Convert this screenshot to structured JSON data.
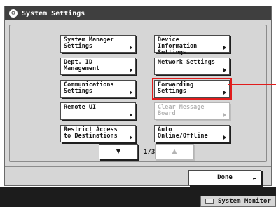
{
  "window": {
    "title": "System Settings",
    "title_icon": "settings-gear-icon"
  },
  "settings_buttons": [
    {
      "label": "System Manager Settings",
      "enabled": true
    },
    {
      "label": "Device Information Settings",
      "enabled": true
    },
    {
      "label": "Dept. ID Management",
      "enabled": true
    },
    {
      "label": "Network Settings",
      "enabled": true
    },
    {
      "label": "Communications Settings",
      "enabled": true
    },
    {
      "label": "Forwarding Settings",
      "enabled": true,
      "highlighted": true
    },
    {
      "label": "Remote UI",
      "enabled": true
    },
    {
      "label": "Clear Message Board",
      "enabled": false
    },
    {
      "label": "Restrict Access to Destinations",
      "enabled": true
    },
    {
      "label": "Auto Online/Offline",
      "enabled": true
    }
  ],
  "pager": {
    "down_glyph": "▼",
    "up_glyph": "▲",
    "page_indicator": "1/3",
    "up_enabled": false
  },
  "done_button": {
    "label": "Done",
    "enter_glyph": "↵"
  },
  "status_bar": {
    "system_monitor_label": "System Monitor"
  },
  "colors": {
    "highlight": "#e11c1c",
    "title_bar": "#3f3f3f",
    "panel": "#d6d6d6",
    "status_bar": "#1c1c1c"
  }
}
